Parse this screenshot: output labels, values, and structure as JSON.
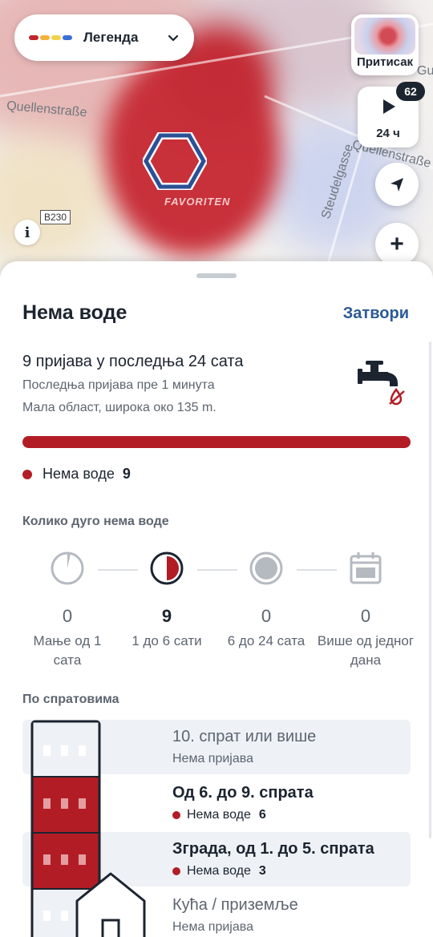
{
  "map": {
    "streets": [
      "Quellenstraße",
      "Quellenstraße",
      "Steudelgasse",
      "Gu"
    ],
    "road_badge": "B230",
    "district_label": "FAVORITEN",
    "legend_button": {
      "label": "Легенда",
      "colors": [
        "#c0272d",
        "#f3b23a",
        "#f2d24b",
        "#3a6fd8"
      ]
    },
    "pressure_button": {
      "label": "Притисак"
    },
    "time_button": {
      "label": "24 ч",
      "badge": "62"
    },
    "info_label": "i",
    "zoom_in_label": "+"
  },
  "sheet": {
    "title": "Нема воде",
    "close_label": "Затвори",
    "summary": {
      "reports": "9 пријава у последња 24 сата",
      "last_report": "Последња пријава пре 1 минута",
      "area": "Мала област, широка око 135 m."
    },
    "legend": {
      "label": "Нема воде",
      "count": "9",
      "color": "#b21d25"
    },
    "duration": {
      "title": "Колико дуго нема воде",
      "items": [
        {
          "value": "0",
          "label": "Мање од 1 сата"
        },
        {
          "value": "9",
          "label": "1 до 6 сати"
        },
        {
          "value": "0",
          "label": "6 до 24 сата"
        },
        {
          "value": "0",
          "label": "Више од једног дана"
        }
      ]
    },
    "floors": {
      "title": "По спратовима",
      "rows": [
        {
          "title": "10. спрат или више",
          "sub": "Нема пријава"
        },
        {
          "title": "Од 6. до 9. спрата",
          "sub": "Нема воде",
          "count": "6"
        },
        {
          "title": "Зграда, од 1. до 5. спрата",
          "sub": "Нема воде",
          "count": "3"
        },
        {
          "title": "Кућа / приземље",
          "sub": "Нема пријава"
        }
      ]
    }
  }
}
